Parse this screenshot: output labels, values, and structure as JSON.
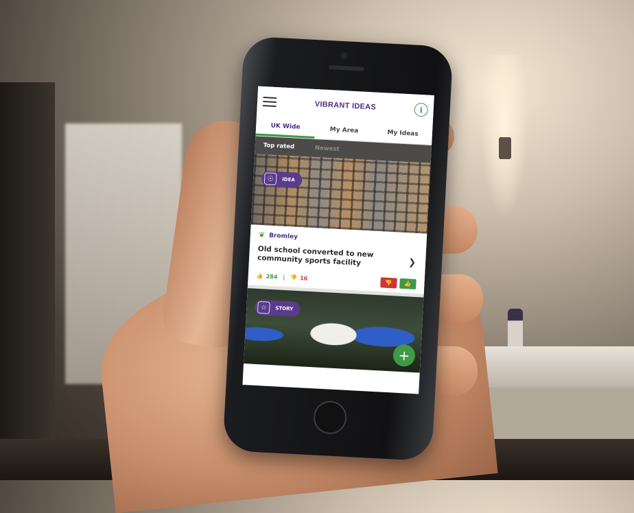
{
  "app": {
    "title": "VIBRANT IDEAS"
  },
  "header": {
    "menu_icon": "hamburger-menu-icon",
    "info_icon": "info-icon",
    "info_glyph": "i"
  },
  "tabs": [
    {
      "label": "UK Wide",
      "active": true
    },
    {
      "label": "My Area",
      "active": false
    },
    {
      "label": "My Ideas",
      "active": false
    }
  ],
  "subtabs": [
    {
      "label": "Top rated",
      "active": true
    },
    {
      "label": "Newest",
      "active": false
    }
  ],
  "cards": [
    {
      "badge": "IDEA",
      "badge_icon": "lightbulb-icon",
      "location": "Bromley",
      "title": "Old school converted to new community sports facility",
      "upvotes": "284",
      "downvotes": "16"
    },
    {
      "badge": "STORY",
      "badge_icon": "story-icon"
    }
  ],
  "fab": {
    "label": "+"
  },
  "colors": {
    "brand_purple": "#4b2e83",
    "brand_green": "#3f9a47",
    "down_red": "#c8373a",
    "subtab_bar": "#4d4a4a"
  }
}
